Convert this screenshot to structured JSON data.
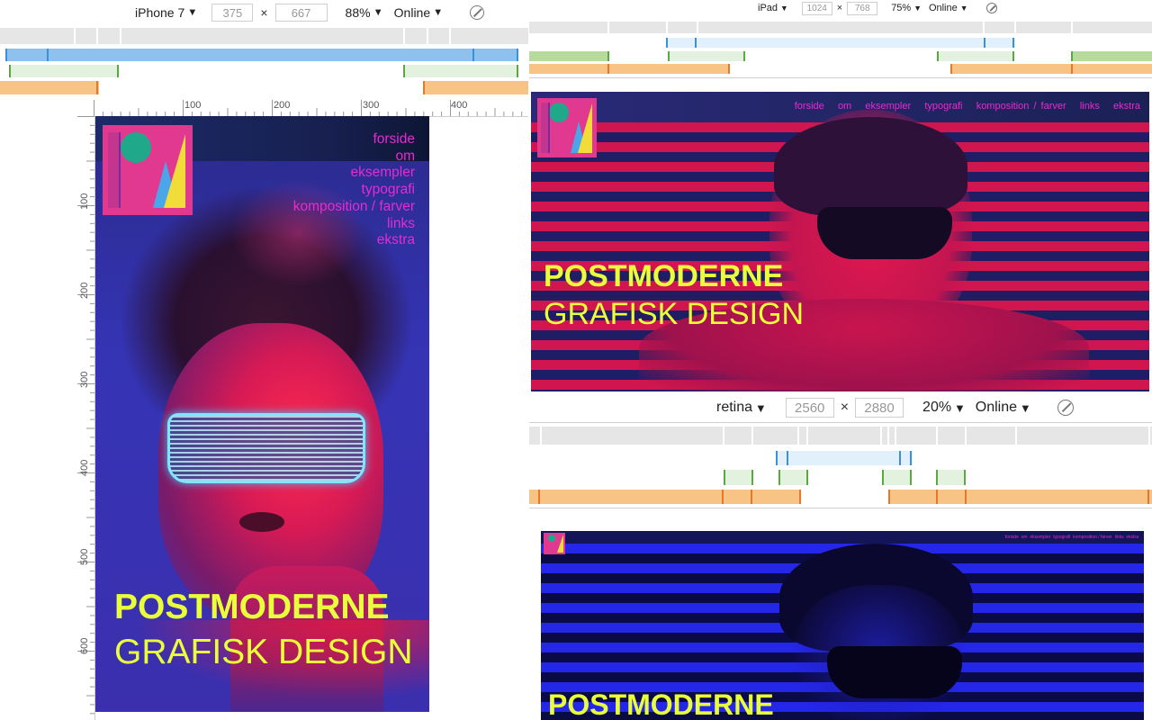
{
  "devices": {
    "phone": {
      "name": "iPhone 7",
      "width": "375",
      "height": "667",
      "zoom": "88%",
      "network": "Online"
    },
    "tablet": {
      "name": "iPad",
      "width": "1024",
      "height": "768",
      "zoom": "75%",
      "network": "Online"
    },
    "desktop": {
      "name": "retina",
      "width": "2560",
      "height": "2880",
      "zoom": "20%",
      "network": "Online"
    }
  },
  "toolbar": {
    "times": "×",
    "rotate_icon": "rotate-icon",
    "dropdown_icon": "▼"
  },
  "ruler": {
    "horizontal": [
      "100",
      "200",
      "300",
      "400"
    ],
    "vertical": [
      "100",
      "200",
      "300",
      "400",
      "500",
      "600"
    ]
  },
  "site": {
    "nav": [
      "forside",
      "om",
      "eksempler",
      "typografi",
      "komposition / farver",
      "links",
      "ekstra"
    ],
    "title_line1": "POSTMODERNE",
    "title_line2": "GRAFISK DESIGN"
  },
  "colors": {
    "nav_magenta": "#e62bd0",
    "title_yellow": "#e9ff3a",
    "logo_pink": "#e0398f",
    "logo_teal": "#1fa88a",
    "stripe_red": "#d1164f",
    "stripe_blue": "#2426e8",
    "mq_blue": "#8fc1ee",
    "mq_green": "#b6db9c",
    "mq_orange": "#f8c486"
  }
}
